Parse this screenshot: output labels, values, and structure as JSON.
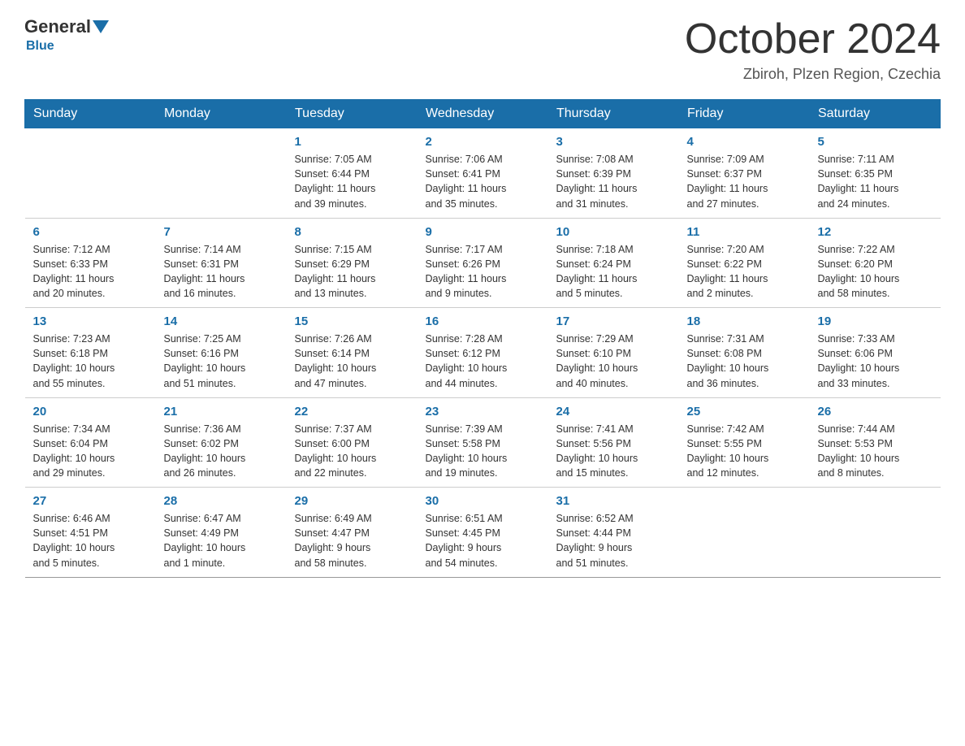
{
  "logo": {
    "general": "General",
    "blue": "Blue"
  },
  "title": "October 2024",
  "subtitle": "Zbiroh, Plzen Region, Czechia",
  "days_of_week": [
    "Sunday",
    "Monday",
    "Tuesday",
    "Wednesday",
    "Thursday",
    "Friday",
    "Saturday"
  ],
  "weeks": [
    [
      {
        "day": "",
        "info": ""
      },
      {
        "day": "",
        "info": ""
      },
      {
        "day": "1",
        "info": "Sunrise: 7:05 AM\nSunset: 6:44 PM\nDaylight: 11 hours\nand 39 minutes."
      },
      {
        "day": "2",
        "info": "Sunrise: 7:06 AM\nSunset: 6:41 PM\nDaylight: 11 hours\nand 35 minutes."
      },
      {
        "day": "3",
        "info": "Sunrise: 7:08 AM\nSunset: 6:39 PM\nDaylight: 11 hours\nand 31 minutes."
      },
      {
        "day": "4",
        "info": "Sunrise: 7:09 AM\nSunset: 6:37 PM\nDaylight: 11 hours\nand 27 minutes."
      },
      {
        "day": "5",
        "info": "Sunrise: 7:11 AM\nSunset: 6:35 PM\nDaylight: 11 hours\nand 24 minutes."
      }
    ],
    [
      {
        "day": "6",
        "info": "Sunrise: 7:12 AM\nSunset: 6:33 PM\nDaylight: 11 hours\nand 20 minutes."
      },
      {
        "day": "7",
        "info": "Sunrise: 7:14 AM\nSunset: 6:31 PM\nDaylight: 11 hours\nand 16 minutes."
      },
      {
        "day": "8",
        "info": "Sunrise: 7:15 AM\nSunset: 6:29 PM\nDaylight: 11 hours\nand 13 minutes."
      },
      {
        "day": "9",
        "info": "Sunrise: 7:17 AM\nSunset: 6:26 PM\nDaylight: 11 hours\nand 9 minutes."
      },
      {
        "day": "10",
        "info": "Sunrise: 7:18 AM\nSunset: 6:24 PM\nDaylight: 11 hours\nand 5 minutes."
      },
      {
        "day": "11",
        "info": "Sunrise: 7:20 AM\nSunset: 6:22 PM\nDaylight: 11 hours\nand 2 minutes."
      },
      {
        "day": "12",
        "info": "Sunrise: 7:22 AM\nSunset: 6:20 PM\nDaylight: 10 hours\nand 58 minutes."
      }
    ],
    [
      {
        "day": "13",
        "info": "Sunrise: 7:23 AM\nSunset: 6:18 PM\nDaylight: 10 hours\nand 55 minutes."
      },
      {
        "day": "14",
        "info": "Sunrise: 7:25 AM\nSunset: 6:16 PM\nDaylight: 10 hours\nand 51 minutes."
      },
      {
        "day": "15",
        "info": "Sunrise: 7:26 AM\nSunset: 6:14 PM\nDaylight: 10 hours\nand 47 minutes."
      },
      {
        "day": "16",
        "info": "Sunrise: 7:28 AM\nSunset: 6:12 PM\nDaylight: 10 hours\nand 44 minutes."
      },
      {
        "day": "17",
        "info": "Sunrise: 7:29 AM\nSunset: 6:10 PM\nDaylight: 10 hours\nand 40 minutes."
      },
      {
        "day": "18",
        "info": "Sunrise: 7:31 AM\nSunset: 6:08 PM\nDaylight: 10 hours\nand 36 minutes."
      },
      {
        "day": "19",
        "info": "Sunrise: 7:33 AM\nSunset: 6:06 PM\nDaylight: 10 hours\nand 33 minutes."
      }
    ],
    [
      {
        "day": "20",
        "info": "Sunrise: 7:34 AM\nSunset: 6:04 PM\nDaylight: 10 hours\nand 29 minutes."
      },
      {
        "day": "21",
        "info": "Sunrise: 7:36 AM\nSunset: 6:02 PM\nDaylight: 10 hours\nand 26 minutes."
      },
      {
        "day": "22",
        "info": "Sunrise: 7:37 AM\nSunset: 6:00 PM\nDaylight: 10 hours\nand 22 minutes."
      },
      {
        "day": "23",
        "info": "Sunrise: 7:39 AM\nSunset: 5:58 PM\nDaylight: 10 hours\nand 19 minutes."
      },
      {
        "day": "24",
        "info": "Sunrise: 7:41 AM\nSunset: 5:56 PM\nDaylight: 10 hours\nand 15 minutes."
      },
      {
        "day": "25",
        "info": "Sunrise: 7:42 AM\nSunset: 5:55 PM\nDaylight: 10 hours\nand 12 minutes."
      },
      {
        "day": "26",
        "info": "Sunrise: 7:44 AM\nSunset: 5:53 PM\nDaylight: 10 hours\nand 8 minutes."
      }
    ],
    [
      {
        "day": "27",
        "info": "Sunrise: 6:46 AM\nSunset: 4:51 PM\nDaylight: 10 hours\nand 5 minutes."
      },
      {
        "day": "28",
        "info": "Sunrise: 6:47 AM\nSunset: 4:49 PM\nDaylight: 10 hours\nand 1 minute."
      },
      {
        "day": "29",
        "info": "Sunrise: 6:49 AM\nSunset: 4:47 PM\nDaylight: 9 hours\nand 58 minutes."
      },
      {
        "day": "30",
        "info": "Sunrise: 6:51 AM\nSunset: 4:45 PM\nDaylight: 9 hours\nand 54 minutes."
      },
      {
        "day": "31",
        "info": "Sunrise: 6:52 AM\nSunset: 4:44 PM\nDaylight: 9 hours\nand 51 minutes."
      },
      {
        "day": "",
        "info": ""
      },
      {
        "day": "",
        "info": ""
      }
    ]
  ]
}
